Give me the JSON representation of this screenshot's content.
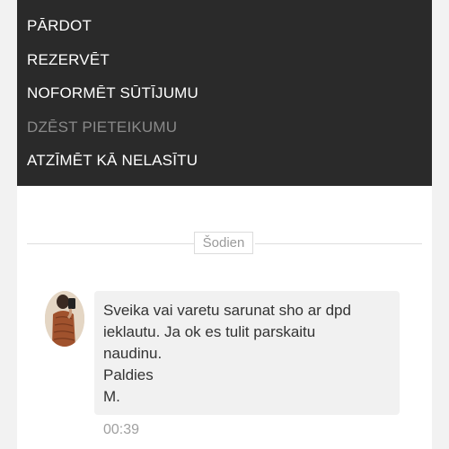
{
  "menu": {
    "items": [
      {
        "label": "PĀRDOT",
        "enabled": true
      },
      {
        "label": "REZERVĒT",
        "enabled": true
      },
      {
        "label": "NOFORMĒT SŪTĪJUMU",
        "enabled": true
      },
      {
        "label": "DZĒST PIETEIKUMU",
        "enabled": false
      },
      {
        "label": "ATZĪMĒT KĀ NELASĪTU",
        "enabled": true
      }
    ]
  },
  "chat": {
    "date_separator": "Šodien",
    "message": {
      "lines": [
        "Sveika vai varetu sarunat sho ar dpd",
        "ieklautu. Ja ok es tulit parskaitu",
        "naudinu.",
        "Paldies",
        "M."
      ],
      "time": "00:39"
    }
  },
  "colors": {
    "menu_background": "#2a2a2a",
    "menu_text": "#ffffff",
    "menu_text_disabled": "#8a8a8a",
    "bubble_background": "#f1f1f1"
  }
}
